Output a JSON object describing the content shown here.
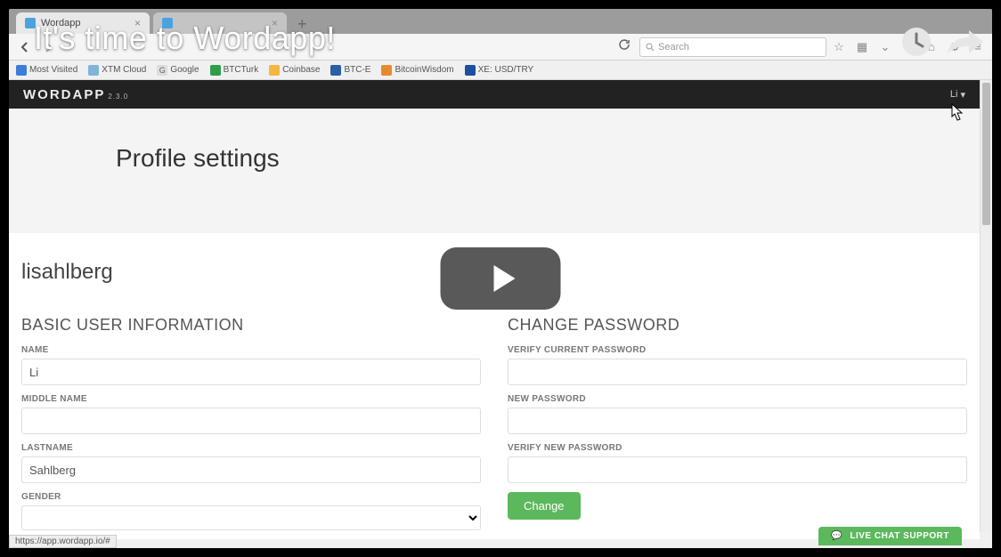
{
  "video": {
    "title": "It's time to Wordapp!"
  },
  "browser": {
    "tab1_label": "Wordapp",
    "search_placeholder": "Search",
    "bookmarks": {
      "most_visited": "Most Visited",
      "xtm_cloud": "XTM Cloud",
      "google": "Google",
      "btcturk": "BTCTurk",
      "coinbase": "Coinbase",
      "btce": "BTC-E",
      "bitcoinwisdom": "BitcoinWisdom",
      "xe": "XE: USD/TRY"
    },
    "status_url": "https://app.wordapp.io/#"
  },
  "app": {
    "logo_main": "WORDAPP",
    "logo_sub": "2.3.0",
    "user_short": "Li",
    "page_title": "Profile settings",
    "username": "lisahlberg",
    "section_basic": "BASIC USER INFORMATION",
    "section_password": "CHANGE PASSWORD",
    "labels": {
      "name": "NAME",
      "middle_name": "MIDDLE NAME",
      "lastname": "LASTNAME",
      "gender": "GENDER",
      "verify_current": "VERIFY CURRENT PASSWORD",
      "new_password": "NEW PASSWORD",
      "verify_new": "VERIFY NEW PASSWORD"
    },
    "values": {
      "name": "Li",
      "middle_name": "",
      "lastname": "Sahlberg"
    },
    "change_button": "Change",
    "live_chat": "LIVE CHAT SUPPORT"
  }
}
